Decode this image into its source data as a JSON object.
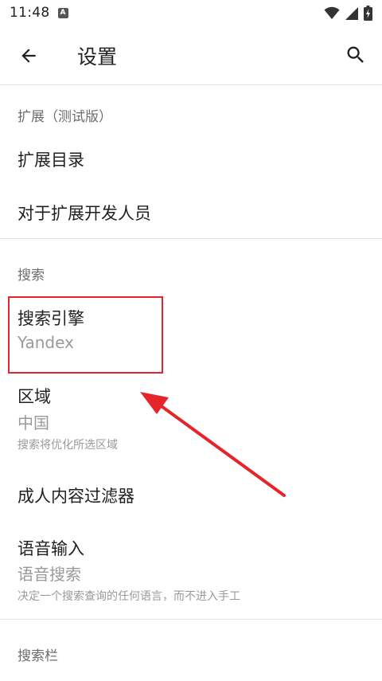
{
  "status_bar": {
    "time": "11:48",
    "notification_badge": "A"
  },
  "app_bar": {
    "title": "设置"
  },
  "sections": {
    "extensions": {
      "header": "扩展（测试版）",
      "items": [
        {
          "title": "扩展目录"
        },
        {
          "title": "对于扩展开发人员"
        }
      ]
    },
    "search": {
      "header": "搜索",
      "search_engine": {
        "title": "搜索引擎",
        "value": "Yandex"
      },
      "region": {
        "title": "区域",
        "value": "中国",
        "description": "搜索将优化所选区域"
      },
      "adult_filter": {
        "title": "成人内容过滤器"
      },
      "voice_input": {
        "title": "语音输入",
        "value": "语音搜索",
        "description": "决定一个搜索查询的任何语言，而不进入手工"
      }
    },
    "search_bar": {
      "header": "搜索栏"
    }
  },
  "annotation": {
    "highlight_color": "#e5252a"
  }
}
